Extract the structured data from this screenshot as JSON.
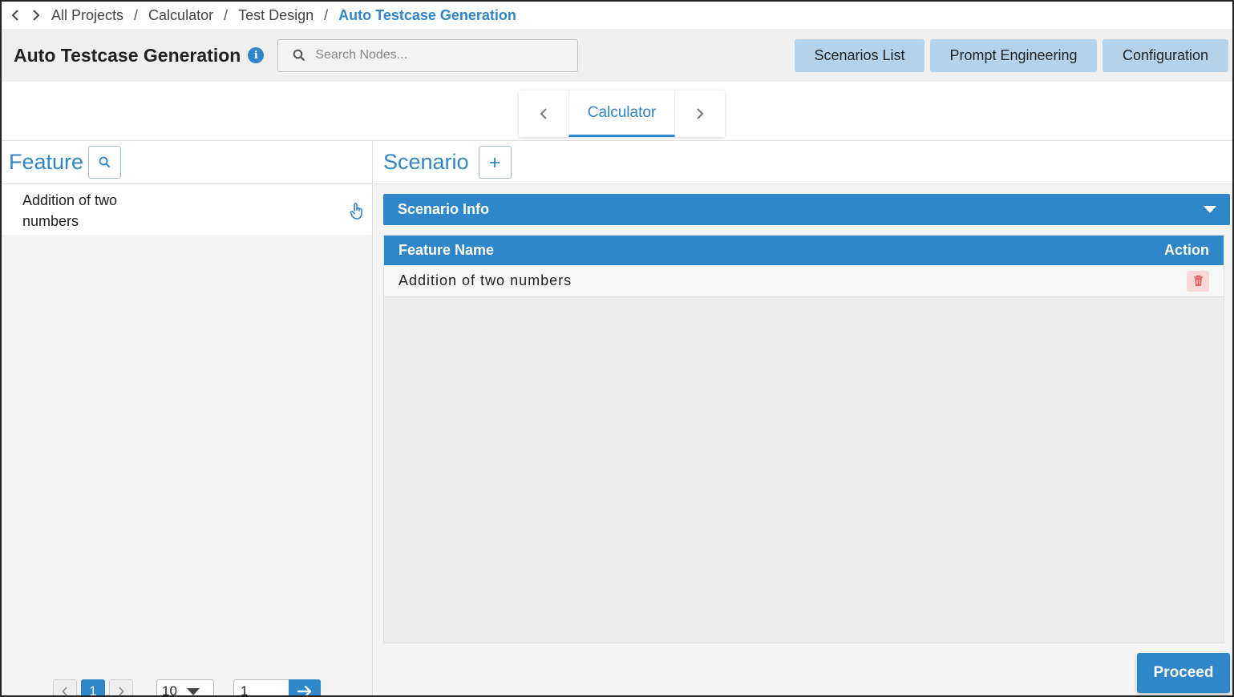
{
  "breadcrumb": {
    "items": [
      "All Projects",
      "Calculator",
      "Test Design"
    ],
    "current": "Auto Testcase Generation",
    "separator": "/"
  },
  "header": {
    "title": "Auto Testcase Generation",
    "info_icon": "i",
    "search_placeholder": "Search Nodes...",
    "buttons": [
      "Scenarios List",
      "Prompt Engineering",
      "Configuration"
    ]
  },
  "tabs": {
    "active": "Calculator"
  },
  "feature_panel": {
    "title": "Feature",
    "items": [
      {
        "label": "Addition of two numbers"
      }
    ],
    "pagination": {
      "current_page": "1",
      "page_size": "10",
      "goto_value": "1"
    }
  },
  "scenario_panel": {
    "title": "Scenario",
    "add_icon": "+",
    "accordion_title": "Scenario Info",
    "table": {
      "columns": [
        "Feature Name",
        "Action"
      ],
      "rows": [
        {
          "feature_name": "Addition of two numbers"
        }
      ]
    },
    "proceed_label": "Proceed"
  },
  "colors": {
    "accent": "#2f86c9",
    "button_light": "#b4d3ea",
    "panel_bg": "#f4f4f4",
    "delete_icon": "#e06666"
  },
  "icons": {
    "nav_back": "chevron-left-icon",
    "nav_forward": "chevron-right-icon",
    "search": "search-icon",
    "info": "info-icon",
    "add": "plus-icon",
    "hand": "pointer-hand-icon",
    "delete": "trash-icon",
    "expand": "caret-down-icon",
    "go": "arrow-right-icon"
  }
}
